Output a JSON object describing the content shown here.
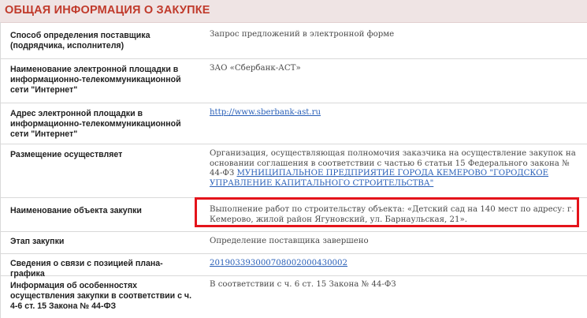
{
  "header": {
    "title": "ОБЩАЯ ИНФОРМАЦИЯ О ЗАКУПКЕ"
  },
  "rows": [
    {
      "label": "Способ определения поставщика (подрядчика, исполнителя)",
      "value": "Запрос предложений в электронной форме"
    },
    {
      "label": "Наименование электронной площадки в информационно-телекоммуникационной сети \"Интернет\"",
      "value": "ЗАО «Сбербанк-АСТ»"
    },
    {
      "label": "Адрес электронной площадки в информационно-телекоммуникационной сети \"Интернет\"",
      "link": "http://www.sberbank-ast.ru"
    },
    {
      "label": "Размещение осуществляет",
      "value": "Организация, осуществляющая полномочия заказчика на осуществление закупок на основании соглашения в соответствии с частью 6 статьи 15 Федерального закона № 44-ФЗ",
      "link": "МУНИЦИПАЛЬНОЕ ПРЕДПРИЯТИЕ ГОРОДА КЕМЕРОВО \"ГОРОДСКОЕ УПРАВЛЕНИЕ КАПИТАЛЬНОГО СТРОИТЕЛЬСТВА\""
    },
    {
      "label": "Наименование объекта закупки",
      "value": "Выполнение работ по строительству объекта: «Детский сад на 140 мест по адресу: г. Кемерово, жилой район Ягуновский, ул. Барнаульская, 21»."
    },
    {
      "label": "Этап закупки",
      "value": "Определение поставщика завершено"
    },
    {
      "label": "Сведения о связи с позицией плана-графика",
      "link": "201903393000708002000430002"
    },
    {
      "label": "Информация об особенностях осуществления закупки в соответствии с ч. 4-6 ст. 15 Закона № 44-ФЗ",
      "value": "В соответствии с ч. 6 ст. 15 Закона № 44-ФЗ"
    }
  ],
  "colors": {
    "header_text": "#c03a2b",
    "header_bg": "#efe4e4",
    "link": "#2a60b8",
    "highlight_border": "#e4141b"
  }
}
